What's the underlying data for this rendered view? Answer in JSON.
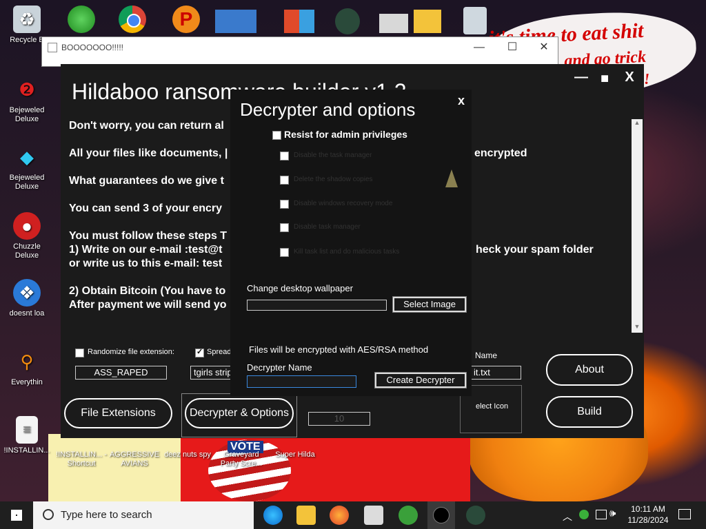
{
  "desktop": {
    "speech_bubble": [
      "it's time to eat shit",
      "and go trick",
      "!"
    ],
    "left_icons": [
      {
        "label": "Recycle B",
        "icon": "recycle-bin-icon"
      },
      {
        "label": "Bejeweled Deluxe",
        "icon": "gem-icon"
      },
      {
        "label": "Bejeweled Deluxe",
        "icon": "diamond-icon"
      },
      {
        "label": "Chuzzle Deluxe",
        "icon": "chuzzle-icon"
      },
      {
        "label": "doesnt loa",
        "icon": "blue-bird-icon"
      },
      {
        "label": "Everythin",
        "icon": "magnifier-icon"
      },
      {
        "label": "!INSTALLIN...",
        "icon": "document-icon"
      }
    ],
    "bottom_icons": [
      {
        "label": "!INSTALLIN... - Shortcut"
      },
      {
        "label": "AGGRESSIVE AVIANS"
      },
      {
        "label": "deez nuts spy"
      },
      {
        "label": "Graveyard Party Scre..."
      },
      {
        "label": "Super Hilda"
      }
    ],
    "poster_text": "VOTE"
  },
  "back_window": {
    "title": "BOOOOOOO!!!!!",
    "controls": [
      "—",
      "☐",
      "✕"
    ]
  },
  "main_window": {
    "title": "Hildaboo ransomware builder v1.2",
    "controls": [
      "—",
      "■",
      "X"
    ],
    "body_lines": [
      "Don't worry, you can return al",
      "All your files like documents, |",
      "What guarantees do we give t",
      "You can send 3 of your encry",
      "You must follow these steps T",
      "1) Write on our e-mail :test@t",
      "or write us to this e-mail: test",
      "2) Obtain Bitcoin (You have to",
      "After payment we will send yo"
    ],
    "right_fragments": [
      "encrypted",
      "heck your spam folder"
    ],
    "randomize_label": "Randomize file extension:",
    "randomize_checked": false,
    "spread_label": "Spread",
    "spread_checked": true,
    "extension_value": "ASS_RAPED",
    "spread_value": "tgirls strip",
    "name_label": "Name",
    "name_value": "it.txt",
    "select_icon_label": "elect Icon",
    "numeric_value": "10",
    "buttons": {
      "file_extensions": "File Extensions",
      "decrypter_options": "Decrypter & Options",
      "about": "About",
      "build": "Build"
    }
  },
  "dialog": {
    "title": "Decrypter and options",
    "close": "x",
    "admin_label": "Resist for admin privileges",
    "admin_checked": false,
    "options": [
      "Disable the task manager",
      "Delete the shadow copies",
      "Disable windows recovery mode",
      "Disable task manager",
      "Kill task list and do malicious tasks"
    ],
    "wallpaper_label": "Change desktop wallpaper",
    "wallpaper_value": "",
    "select_image": "Select Image",
    "method_text": "Files will be encrypted with AES/RSA method",
    "decrypter_name_label": "Decrypter Name",
    "decrypter_name_value": "",
    "create_decrypter": "Create Decrypter"
  },
  "taskbar": {
    "search_placeholder": "Type here to search",
    "time": "10:11 AM",
    "date": "11/28/2024",
    "pinned": [
      "edge-icon",
      "file-explorer-icon",
      "firefox-icon",
      "app-icon",
      "green-people-icon",
      "circle-app-icon",
      "ninja-icon"
    ]
  }
}
